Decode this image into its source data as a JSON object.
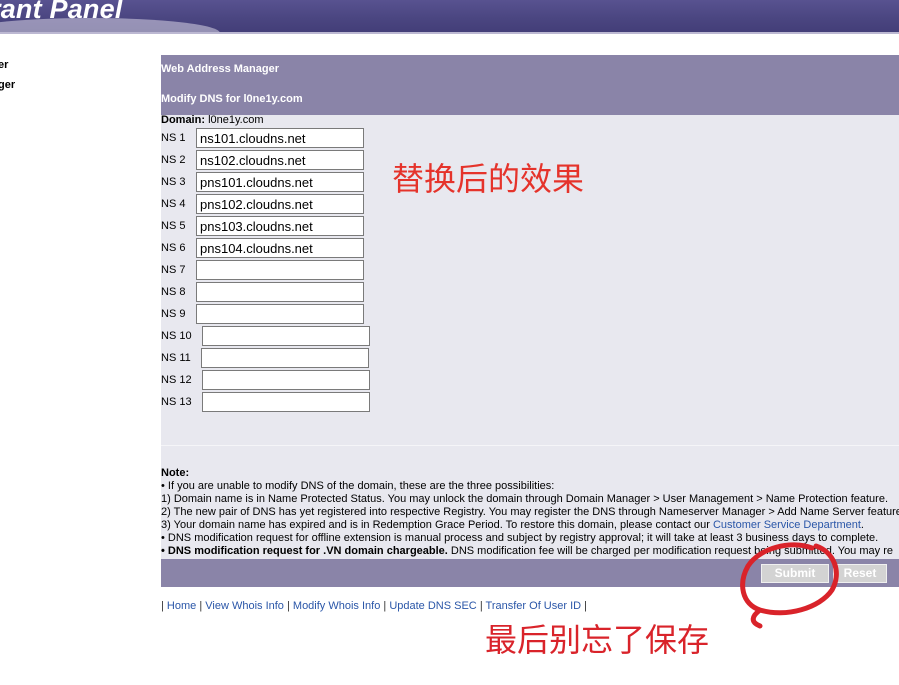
{
  "banner": {
    "title": "rant Panel"
  },
  "left_nav": [
    "er",
    "ger"
  ],
  "panel": {
    "title": "Web Address Manager",
    "subtitle": "Modify DNS for l0ne1y.com",
    "domain_label": "Domain:",
    "domain_value": "l0ne1y.com"
  },
  "ns": [
    {
      "label": "NS 1",
      "value": "ns101.cloudns.net"
    },
    {
      "label": "NS 2",
      "value": "ns102.cloudns.net"
    },
    {
      "label": "NS 3",
      "value": "pns101.cloudns.net"
    },
    {
      "label": "NS 4",
      "value": "pns102.cloudns.net"
    },
    {
      "label": "NS 5",
      "value": "pns103.cloudns.net"
    },
    {
      "label": "NS 6",
      "value": "pns104.cloudns.net"
    },
    {
      "label": "NS 7",
      "value": ""
    },
    {
      "label": "NS 8",
      "value": ""
    },
    {
      "label": "NS 9",
      "value": ""
    },
    {
      "label": "NS 10",
      "value": ""
    },
    {
      "label": "NS 11",
      "value": ""
    },
    {
      "label": "NS 12",
      "value": ""
    },
    {
      "label": "NS 13",
      "value": ""
    }
  ],
  "notes": {
    "heading": "Note:",
    "l1": "• If you are unable to modify DNS of the domain, these are the three possibilities:",
    "l2": "1) Domain name is in Name Protected Status. You may unlock the domain through Domain Manager > User Management > Name Protection feature.",
    "l3": "2) The new pair of DNS has yet registered into respective Registry. You may register the DNS through Nameserver Manager > Add Name Server feature.",
    "l4_pre": "3) Your domain name has expired and is in Redemption Grace Period. To restore this domain, please contact our ",
    "l4_link": "Customer Service Department",
    "l4_post": ".",
    "l5": "• DNS modification request for offline extension is manual process and subject by registry approval; it will take at least 3 business days to complete.",
    "l6_bold": "• DNS modification request for .VN domain chargeable.",
    "l6_rest": " DNS modification fee will be charged per modification request being submitted. You may re"
  },
  "buttons": {
    "submit": "Submit",
    "reset": "Reset"
  },
  "footer_links": {
    "sep": "|",
    "home": "Home",
    "view_whois": "View Whois Info",
    "modify_whois": "Modify Whois Info",
    "update_dns_sec": "Update DNS SEC",
    "transfer_user": "Transfer Of User ID"
  },
  "annotations": {
    "after_replace": "替换后的效果",
    "remember_save": "最后别忘了保存"
  },
  "colors": {
    "header": "#8a84a8",
    "panel": "#e8e8ef",
    "annotation": "#e5332b",
    "link": "#2a56a8"
  }
}
